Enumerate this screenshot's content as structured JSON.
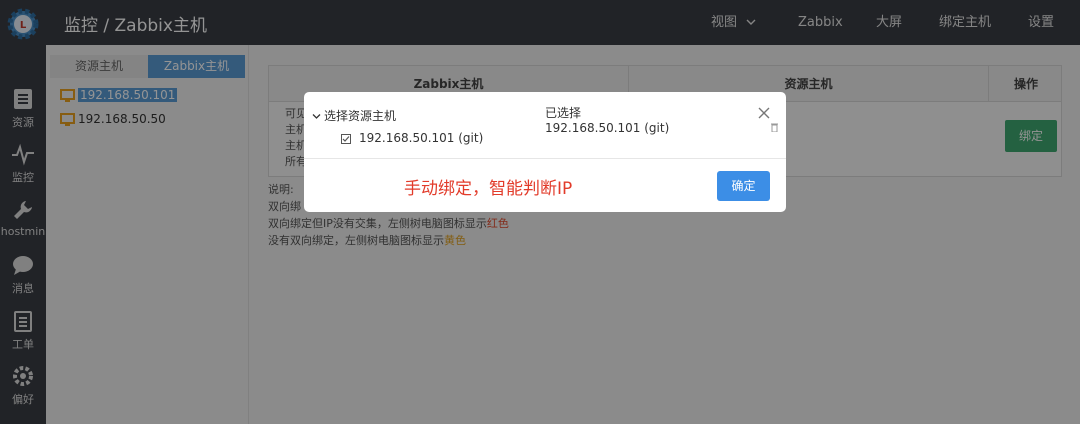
{
  "header": {
    "title": "监控 / Zabbix主机",
    "nav": [
      {
        "label": "视图"
      },
      {
        "label": "Zabbix"
      },
      {
        "label": "大屏"
      },
      {
        "label": "绑定主机"
      },
      {
        "label": "设置"
      }
    ]
  },
  "sidebar": {
    "items": [
      {
        "label": "资源",
        "icon": "list-icon"
      },
      {
        "label": "监控",
        "icon": "pulse-icon"
      },
      {
        "label": "hostmin",
        "icon": "wrench-icon"
      },
      {
        "label": "消息",
        "icon": "chat-icon"
      },
      {
        "label": "工单",
        "icon": "clipboard-icon"
      },
      {
        "label": "偏好",
        "icon": "gear-icon"
      }
    ]
  },
  "tree": {
    "tabs": [
      {
        "label": "资源主机"
      },
      {
        "label": "Zabbix主机"
      }
    ],
    "hosts": [
      {
        "ip": "192.168.50.101",
        "selected": true
      },
      {
        "ip": "192.168.50.50",
        "selected": false
      }
    ]
  },
  "table": {
    "headers": [
      "Zabbix主机",
      "资源主机",
      "操作"
    ],
    "info_lines": [
      "可见",
      "主机",
      "主机",
      "所有"
    ],
    "bind_label": "绑定"
  },
  "notes": {
    "label": "说明:",
    "line1": "双向绑",
    "line2_prefix": "双向绑定但IP没有交集，左侧树电脑图标显示",
    "line2_color": "红色",
    "line3_prefix": "没有双向绑定，左侧树电脑图标显示",
    "line3_color": "黄色"
  },
  "modal": {
    "select_title": "选择资源主机",
    "option_label": "192.168.50.101 (git)",
    "selected_title": "已选择",
    "selected_value": "192.168.50.101 (git)",
    "hint": "手动绑定，智能判断IP",
    "confirm_label": "确定"
  },
  "colors": {
    "topbar": "#3a3d44",
    "accent": "#5b9bd5",
    "bind_green": "#3fa871",
    "confirm_blue": "#3c8ee6",
    "hint_red": "#e23b2a",
    "monitor_orange": "#e8a020"
  }
}
